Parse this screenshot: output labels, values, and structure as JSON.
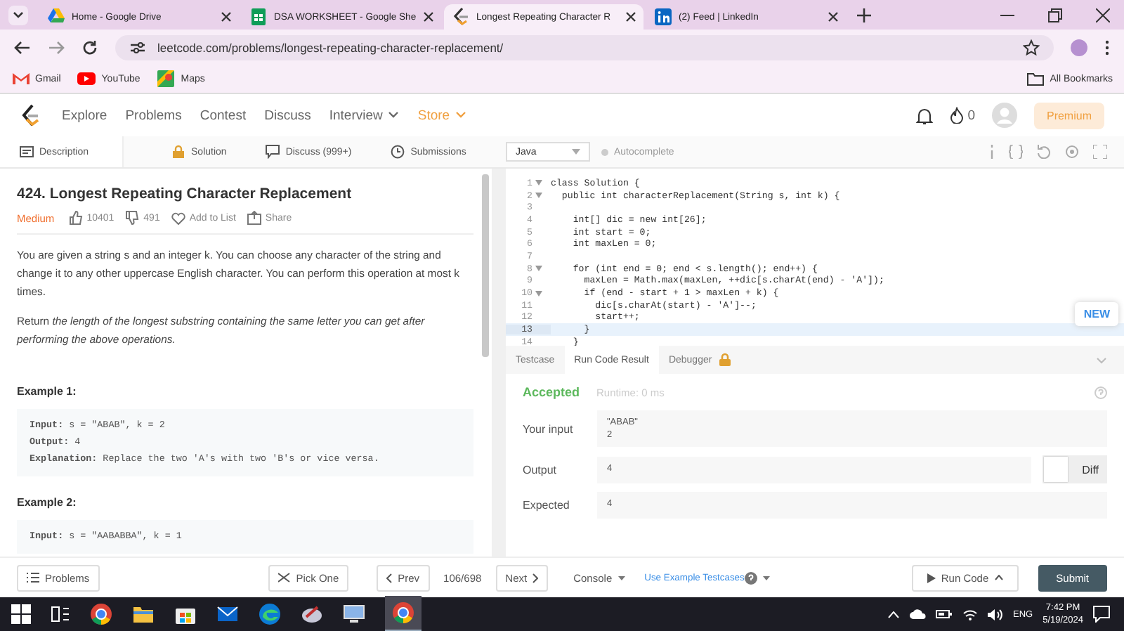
{
  "browser": {
    "tabs": [
      {
        "title": "Home - Google Drive",
        "selected": false
      },
      {
        "title": "DSA WORKSHEET - Google She",
        "selected": false
      },
      {
        "title": "Longest Repeating Character R",
        "selected": true
      },
      {
        "title": "(2) Feed | LinkedIn",
        "selected": false
      }
    ],
    "address": "leetcode.com/problems/longest-repeating-character-replacement/",
    "bookmarks": [
      {
        "label": "Gmail"
      },
      {
        "label": "YouTube"
      },
      {
        "label": "Maps"
      }
    ],
    "all_bookmarks": "All Bookmarks"
  },
  "nav": {
    "items": [
      {
        "label": "Explore",
        "dropdown": false,
        "highlighted": false
      },
      {
        "label": "Problems",
        "dropdown": false,
        "highlighted": false
      },
      {
        "label": "Contest",
        "dropdown": false,
        "highlighted": false
      },
      {
        "label": "Discuss",
        "dropdown": false,
        "highlighted": false
      },
      {
        "label": "Interview",
        "dropdown": true,
        "highlighted": false
      },
      {
        "label": "Store",
        "dropdown": true,
        "highlighted": true
      }
    ],
    "streak": "0",
    "premium": "Premium"
  },
  "panel_tabs": [
    {
      "label": "Description",
      "selected": true
    },
    {
      "label": "Solution",
      "selected": false
    },
    {
      "label": "Discuss (999+)",
      "selected": false
    },
    {
      "label": "Submissions",
      "selected": false
    }
  ],
  "editor_toolbar": {
    "language": "Java",
    "autocomplete": "Autocomplete"
  },
  "problem": {
    "title": "424. Longest Repeating Character Replacement",
    "difficulty": "Medium",
    "likes": "10401",
    "dislikes": "491",
    "add_to_list": "Add to List",
    "share": "Share",
    "paragraphs": [
      "You are given a string s and an integer k. You can choose any character of the string and change it to any other uppercase English character. You can perform this operation at most k times.",
      "Return *the length of the longest substring containing the same letter you can get after performing the above operations.*"
    ],
    "examples": [
      {
        "heading": "Example 1:",
        "lines": [
          "**Input:** s = \"ABAB\", k = 2",
          "**Output:** 4",
          "**Explanation:** Replace the two 'A's with two 'B's or vice versa."
        ]
      },
      {
        "heading": "Example 2:",
        "lines": [
          "**Input:** s = \"AABABBA\", k = 1"
        ]
      }
    ]
  },
  "code": {
    "lines": [
      {
        "number": "1",
        "text": "class Solution {",
        "foldable": true,
        "current": false
      },
      {
        "number": "2",
        "text": "  public int characterReplacement(String s, int k) {",
        "foldable": true,
        "current": false
      },
      {
        "number": "3",
        "foldable": false,
        "current": false
      },
      {
        "number": "4",
        "text": "    int[] dic = new int[26];",
        "foldable": false,
        "current": false
      },
      {
        "number": "5",
        "text": "    int start = 0;",
        "foldable": false,
        "current": false
      },
      {
        "number": "6",
        "text": "    int maxLen = 0;",
        "foldable": false,
        "current": false
      },
      {
        "number": "7",
        "foldable": false,
        "current": false
      },
      {
        "number": "8",
        "text": "    for (int end = 0; end < s.length(); end++) {",
        "foldable": true,
        "current": false
      },
      {
        "number": "9",
        "text": "      maxLen = Math.max(maxLen, ++dic[s.charAt(end) - 'A']);",
        "foldable": false,
        "current": false
      },
      {
        "number": "10",
        "text": "      if (end - start + 1 > maxLen + k) {",
        "foldable": true,
        "current": false
      },
      {
        "number": "11",
        "text": "        dic[s.charAt(start) - 'A']--;",
        "foldable": false,
        "current": false
      },
      {
        "number": "12",
        "text": "        start++;",
        "foldable": false,
        "current": false
      },
      {
        "number": "13",
        "text": "      }",
        "foldable": false,
        "current": true
      },
      {
        "number": "14",
        "text": "    }",
        "foldable": false,
        "current": false
      }
    ],
    "new_badge": "NEW"
  },
  "result_tabs": [
    {
      "label": "Testcase",
      "selected": false,
      "locked": false
    },
    {
      "label": "Run Code Result",
      "selected": true,
      "locked": false
    },
    {
      "label": "Debugger",
      "selected": false,
      "locked": true
    }
  ],
  "result": {
    "status": "Accepted",
    "runtime": "Runtime: 0 ms",
    "rows": [
      {
        "label": "Your input",
        "lines": [
          "\"ABAB\"",
          "2"
        ]
      },
      {
        "label": "Output",
        "lines": [
          "4"
        ]
      },
      {
        "label": "Expected",
        "lines": [
          "4"
        ]
      }
    ],
    "diff": "Diff"
  },
  "footer": {
    "problems": "Problems",
    "pick_one": "Pick One",
    "prev": "Prev",
    "counter": "106/698",
    "next": "Next",
    "console": "Console",
    "example_testcases": "Use Example Testcases",
    "run_code": "Run Code",
    "submit": "Submit"
  },
  "taskbar": {
    "language": "ENG",
    "time": "7:42 PM",
    "date": "5/19/2024"
  }
}
